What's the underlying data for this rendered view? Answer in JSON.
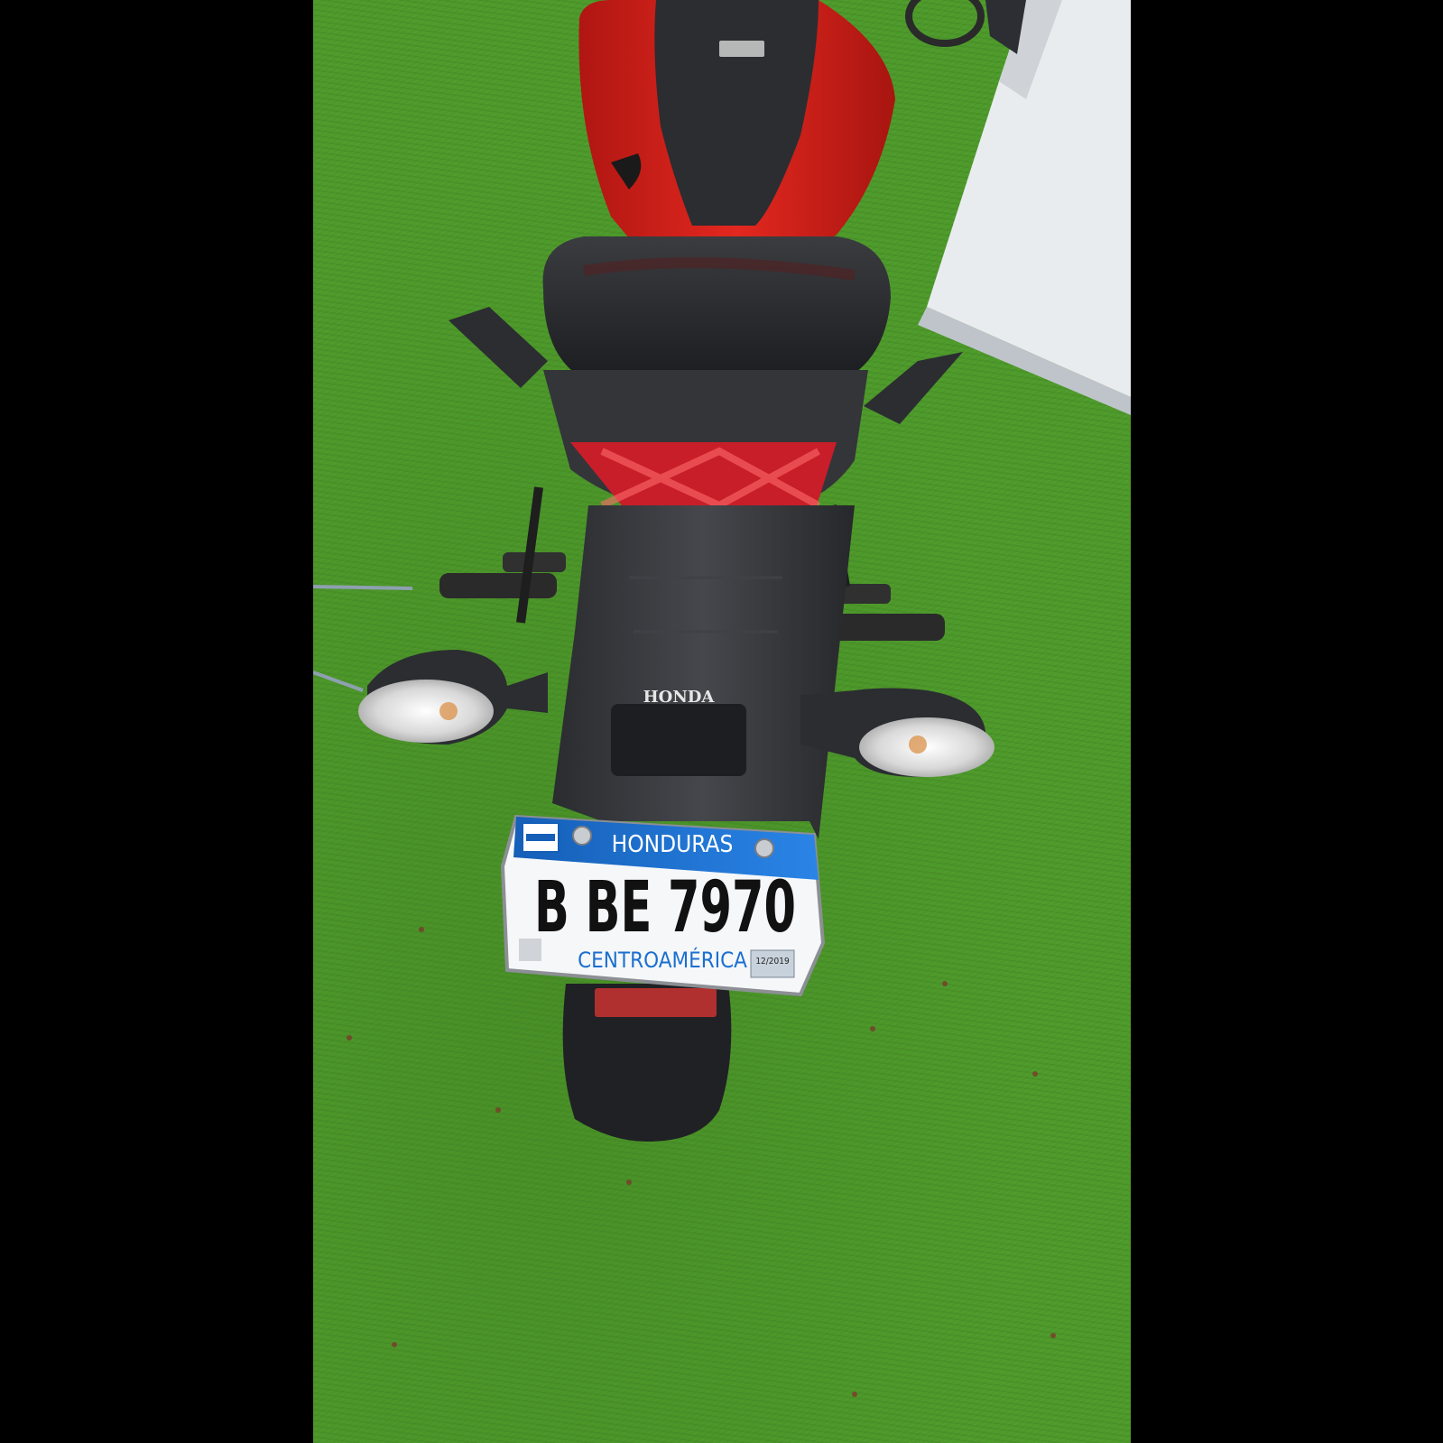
{
  "photo": {
    "brand": "HONDA",
    "plate": {
      "country": "HONDURAS",
      "number": "B BE 7970",
      "region": "CENTROAMÉRICA",
      "sticker": "12/2019"
    },
    "colors": {
      "grass": "#4d9a2a",
      "body_red": "#d8201c",
      "plastic": "#2d2f33",
      "plate_blue": "#1b6fd0",
      "tail_light": "#c81e2a"
    }
  }
}
